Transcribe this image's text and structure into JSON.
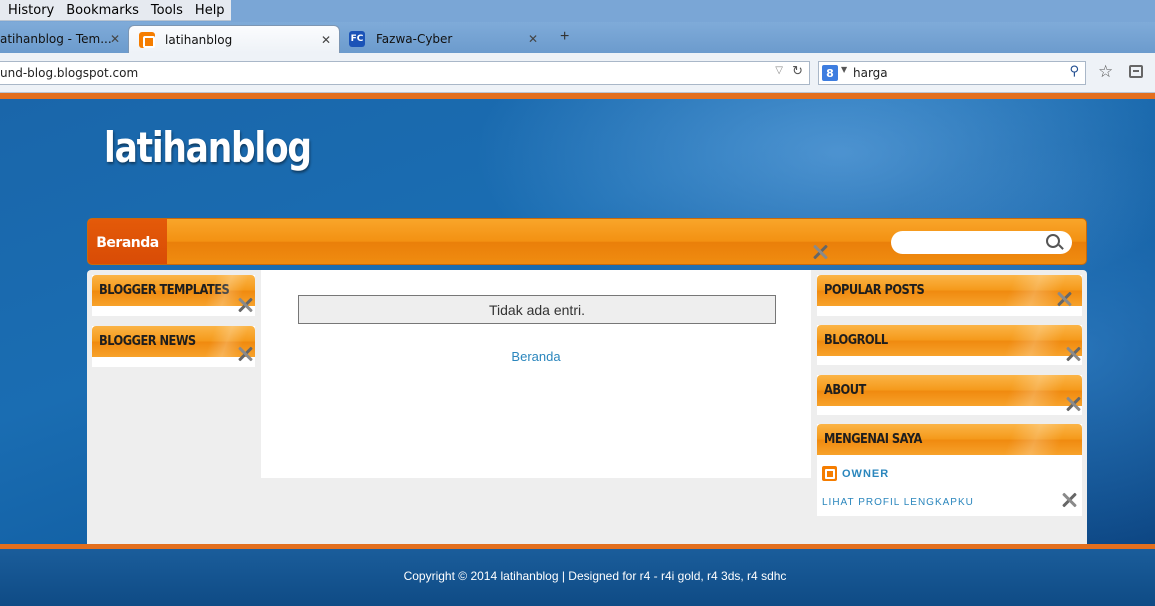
{
  "browser": {
    "menu": [
      "History",
      "Bookmarks",
      "Tools",
      "Help"
    ],
    "tabs": [
      {
        "title": "atihanblog - Tem...",
        "favicon": "blogger-icon"
      },
      {
        "title": "latihanblog",
        "favicon": "blogger-icon"
      },
      {
        "title": "Fazwa-Cyber",
        "favicon": "fc-icon",
        "favicon_text": "FC"
      }
    ],
    "close_glyph": "✕",
    "newtab_glyph": "+",
    "url": "und-blog.blogspot.com",
    "search_engine_glyph": "8",
    "search_query": "harga"
  },
  "blog": {
    "title": "latihanblog",
    "nav_home": "Beranda",
    "no_posts": "Tidak ada entri.",
    "home_link": "Beranda",
    "left_widgets": [
      "BLOGGER TEMPLATES",
      "BLOGGER NEWS"
    ],
    "right_widgets": [
      "POPULAR POSTS",
      "BLOGROLL",
      "ABOUT",
      "MENGENAI SAYA"
    ],
    "profile": {
      "name": "OWNER",
      "link": "LIHAT PROFIL LENGKAPKU"
    },
    "footer": "Copyright © 2014 latihanblog | Designed for r4 - r4i gold, r4 3ds, r4 sdhc"
  },
  "colors": {
    "accent_orange": "#f39112",
    "link_blue": "#2a86bd",
    "background_blue": "#1a66aa"
  }
}
